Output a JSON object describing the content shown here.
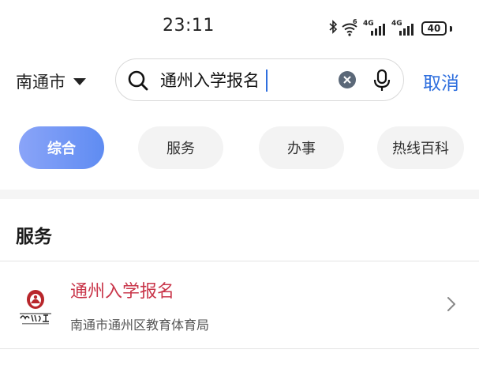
{
  "status_bar": {
    "time": "23:11",
    "wifi_badge": "6",
    "signal_1_label": "4G",
    "signal_2_label": "4G",
    "battery": "40"
  },
  "search": {
    "city": "南通市",
    "query": "通州入学报名",
    "cancel_label": "取消"
  },
  "tabs": [
    {
      "label": "综合",
      "active": true
    },
    {
      "label": "服务",
      "active": false
    },
    {
      "label": "办事",
      "active": false
    },
    {
      "label": "热线百科",
      "active": false
    }
  ],
  "section": {
    "title": "服务"
  },
  "results": [
    {
      "title": "通州入学报名",
      "subtitle": "南通市通州区教育体育局",
      "logo_text": "通州教育",
      "icon": "education-bureau-logo"
    }
  ],
  "colors": {
    "accent": "#2f6fde",
    "tab_active_start": "#8aa4f8",
    "tab_active_end": "#5f8cf2",
    "result_title": "#c9364a",
    "logo_red": "#b8262b"
  }
}
